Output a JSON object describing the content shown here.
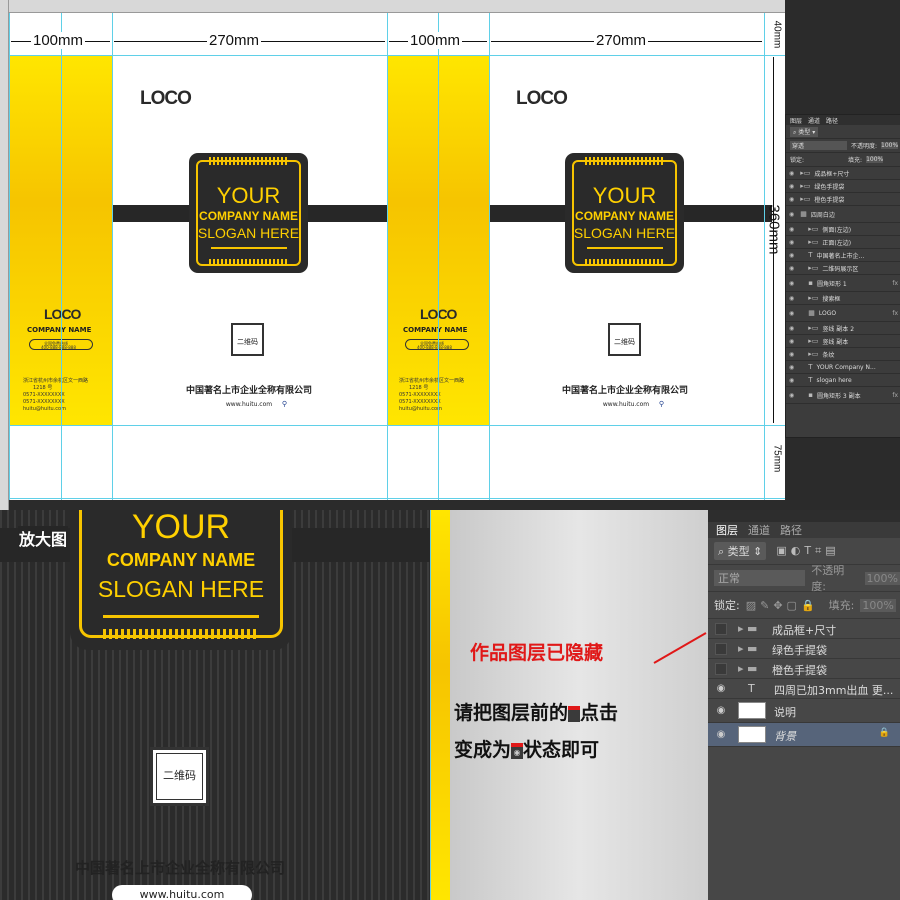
{
  "dimensions": {
    "left_width": "100mm",
    "front_width": "270mm",
    "right_side_width": "100mm",
    "back_width": "270mm",
    "top_margin": "40mm",
    "height": "360mm",
    "bottom_fold": "75mm"
  },
  "bag": {
    "logo": "LOCO",
    "badge_line1": "YOUR",
    "badge_line2": "COMPANY NAME",
    "badge_line3": "SLOGAN HERE",
    "qr_label": "二维码",
    "company_full_name": "中国著名上市企业全称有限公司",
    "url": "www.huitu.com",
    "side_company_name": "COMPANY NAME",
    "side_hotline_label": "全国免费热线",
    "side_hotline_number": "400-888-888-888",
    "side_address": "浙江省杭州市余杭区文一西路",
    "side_address2": "1218 号",
    "side_phone1": "0571-XXXXXXXX",
    "side_phone2": "0571-XXXXXXXX",
    "side_email": "huitu@huitu.com"
  },
  "small_layers_panel": {
    "tabs": [
      "图层",
      "通道",
      "路径"
    ],
    "filter_label": "类型",
    "blend_mode": "穿透",
    "opacity_label": "不透明度:",
    "opacity_value": "100%",
    "lock_label": "锁定:",
    "fill_label": "填充:",
    "fill_value": "100%",
    "layers": [
      {
        "name": "成品框+尺寸",
        "type": "folder"
      },
      {
        "name": "绿色手提袋",
        "type": "folder"
      },
      {
        "name": "橙色手提袋",
        "type": "folder"
      },
      {
        "name": "四周白边",
        "type": "image"
      },
      {
        "name": "侧面(左边)",
        "type": "folder"
      },
      {
        "name": "正面(左边)",
        "type": "folder"
      },
      {
        "name": "中国著名上市企...",
        "type": "text"
      },
      {
        "name": "二维码展示区",
        "type": "folder"
      },
      {
        "name": "圆角矩形 1",
        "type": "shape"
      },
      {
        "name": "搜索框",
        "type": "folder"
      },
      {
        "name": "LOGO",
        "type": "image"
      },
      {
        "name": "竖线 副本 2",
        "type": "folder"
      },
      {
        "name": "竖线 副本",
        "type": "folder"
      },
      {
        "name": "条纹",
        "type": "folder"
      },
      {
        "name": "YOUR Company N...",
        "type": "text"
      },
      {
        "name": "slogan here",
        "type": "text"
      },
      {
        "name": "圆角矩形 3 副本",
        "type": "shape"
      }
    ],
    "fx": "fx"
  },
  "zoom_label": "放大图",
  "note": {
    "hidden_title": "作品图层已隐藏",
    "line1_a": "请把图层前的",
    "line1_b": "点击",
    "line2_a": "变成为",
    "line2_b": "状态即可"
  },
  "big_layers_panel": {
    "tabs": [
      "图层",
      "通道",
      "路径"
    ],
    "filter_label": "类型",
    "blend_mode": "正常",
    "opacity_label": "不透明度:",
    "opacity_value": "100%",
    "lock_label": "锁定:",
    "fill_label": "填充:",
    "fill_value": "100%",
    "layers": [
      {
        "name": "成品框+尺寸",
        "visible": false,
        "type": "folder"
      },
      {
        "name": "绿色手提袋",
        "visible": false,
        "type": "folder"
      },
      {
        "name": "橙色手提袋",
        "visible": false,
        "type": "folder"
      },
      {
        "name": "四周已加3mm出血 更...",
        "visible": true,
        "type": "text"
      },
      {
        "name": "说明",
        "visible": true,
        "type": "image"
      },
      {
        "name": "背景",
        "visible": true,
        "type": "background"
      }
    ]
  },
  "colors": {
    "bag_yellow": "#ffd800",
    "band_dark": "#272727",
    "note_red": "#e01818",
    "guide_cyan": "#5fd0e8"
  }
}
